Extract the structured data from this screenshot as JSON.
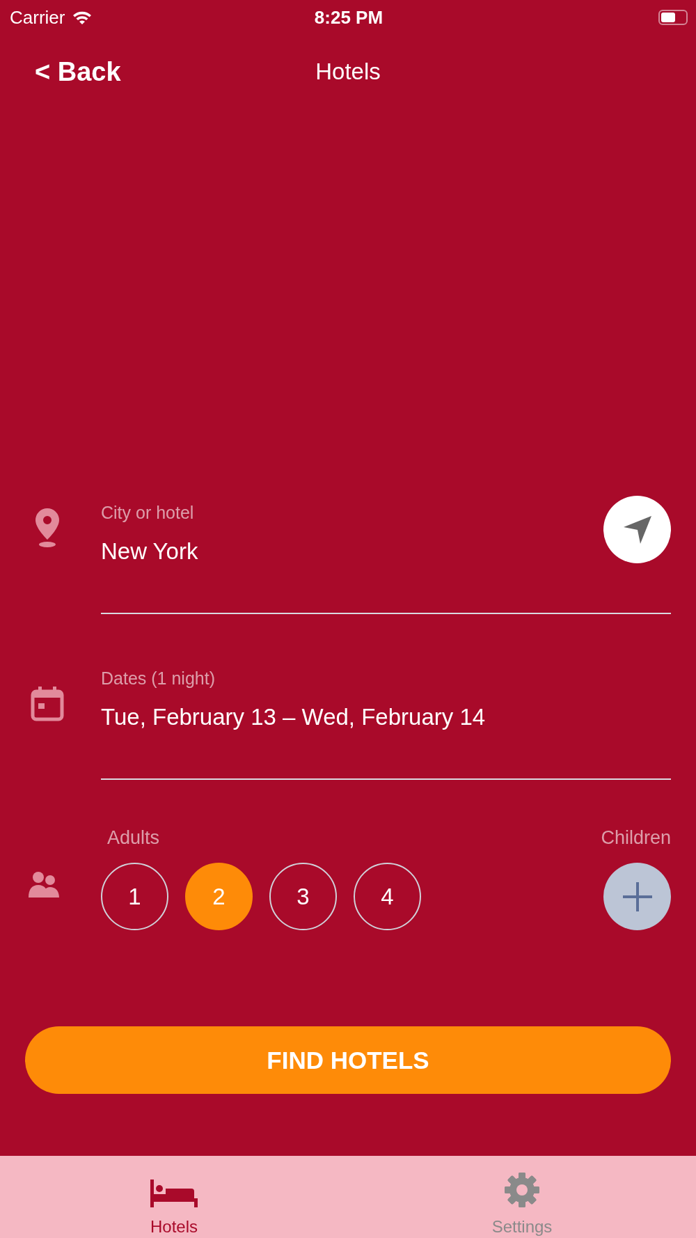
{
  "status_bar": {
    "carrier": "Carrier",
    "time": "8:25 PM"
  },
  "nav": {
    "back": "< Back",
    "title": "Hotels"
  },
  "fields": [
    {
      "kind": "location",
      "label": "City or hotel",
      "value": "New York"
    },
    {
      "kind": "dates",
      "label": "Dates (1 night)",
      "value": "Tue, February 13 – Wed, February 14"
    }
  ],
  "guests": {
    "adults_label": "Adults",
    "children_label": "Children",
    "adults": [
      {
        "label": "1",
        "selected": false
      },
      {
        "label": "2",
        "selected": true
      },
      {
        "label": "3",
        "selected": false
      },
      {
        "label": "4",
        "selected": false
      }
    ]
  },
  "find_button": "FIND HOTELS",
  "tabs": [
    {
      "kind": "hotels",
      "label": "Hotels",
      "selected": true
    },
    {
      "kind": "settings",
      "label": "Settings",
      "selected": false
    }
  ]
}
